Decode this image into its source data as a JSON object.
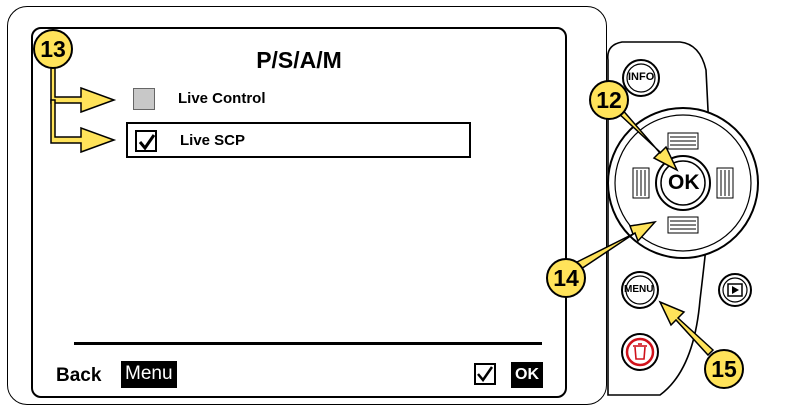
{
  "screen": {
    "title": "P/S/A/M",
    "items": [
      {
        "label": "Live Control",
        "checked": false,
        "selected": false
      },
      {
        "label": "Live SCP",
        "checked": true,
        "selected": true
      }
    ],
    "footer": {
      "back_label": "Back",
      "menu_key": "Menu",
      "ok_key": "OK"
    }
  },
  "controls": {
    "info_label": "INFO",
    "ok_label": "OK",
    "menu_label": "MENU"
  },
  "callouts": [
    "13",
    "12",
    "14",
    "15"
  ],
  "colors": {
    "callout": "#ffe35a",
    "trash": "#d0121b"
  },
  "icons": {
    "checkmark": "checkmark-icon",
    "play": "play-icon",
    "trash": "trash-icon"
  }
}
